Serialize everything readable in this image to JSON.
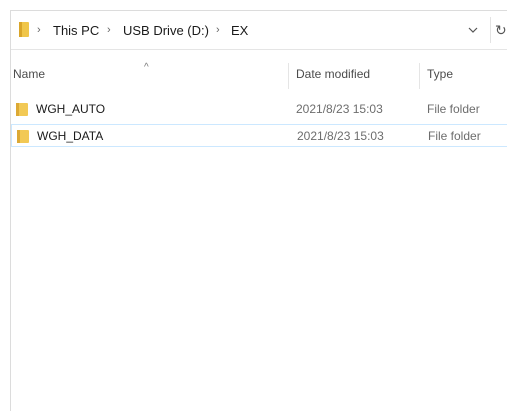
{
  "breadcrumb": {
    "items": [
      "This PC",
      "USB Drive (D:)",
      "EX"
    ],
    "separator": "›"
  },
  "columns": {
    "name": "Name",
    "date_modified": "Date modified",
    "type": "Type"
  },
  "files": [
    {
      "name": "WGH_AUTO",
      "date": "2021/8/23 15:03",
      "type": "File folder"
    },
    {
      "name": "WGH_DATA",
      "date": "2021/8/23 15:03",
      "type": "File folder"
    }
  ],
  "icons": {
    "folder": "folder-icon",
    "dropdown": "chevron-down-icon",
    "refresh": "refresh-icon",
    "sort": "sort-up-icon"
  },
  "colors": {
    "folder_yellow": "#e8b83c",
    "selection_border": "#cce8ff"
  }
}
